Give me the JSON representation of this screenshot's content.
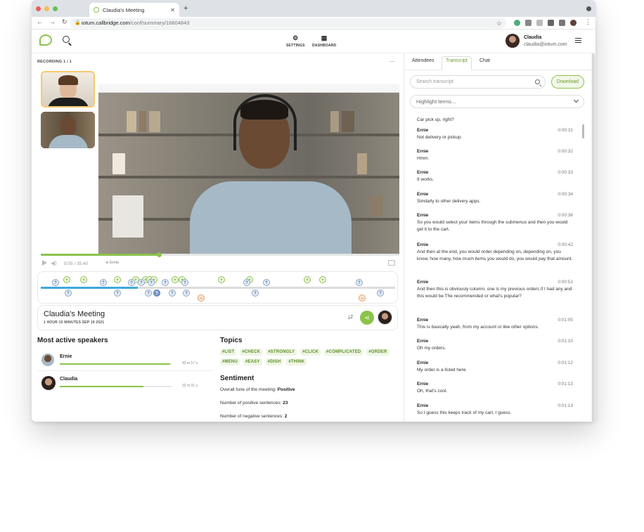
{
  "browser": {
    "tab_title": "Claudia's Meeting",
    "url_domain": "iotum.callbridge.com",
    "url_path": "/conf/summary/16604843"
  },
  "header": {
    "settings_label": "SETTINGS",
    "dashboard_label": "DASHBOARD",
    "user_name": "Claudia",
    "user_email": "claudia@iotum.com"
  },
  "recording": {
    "label": "RECORDING 1 / 1",
    "time_current": "9:05",
    "time_total": "35:40",
    "progress": 0.33,
    "active_speaker": "Ernie"
  },
  "meeting": {
    "title": "Claudia's Meeting",
    "meta": "1 HOUR 15 MINUTES   SEP 19 2021",
    "downloads": "2"
  },
  "speakers": {
    "heading": "Most active speakers",
    "items": [
      {
        "name": "Ernie",
        "duration": "43 m 17 s",
        "share": 0.99
      },
      {
        "name": "Claudia",
        "duration": "32 m 31 s",
        "share": 0.75
      }
    ]
  },
  "topics": {
    "heading": "Topics",
    "tags": [
      "#LIST",
      "#CHECK",
      "#STRONGLY",
      "#CLICK",
      "#COMPLICATED",
      "#ORDER",
      "#MENU",
      "#EASY",
      "#DISH",
      "#THINK"
    ]
  },
  "sentiment": {
    "heading": "Sentiment",
    "tone_label": "Overall tone of the meeting:",
    "tone_value": "Positive",
    "positive_label": "Number of positive sentences:",
    "positive_value": "23",
    "negative_label": "Number of negative sentences:",
    "negative_value": "2"
  },
  "panel": {
    "tabs": [
      "Attendees",
      "Transcript",
      "Chat"
    ],
    "active_tab": "Transcript",
    "search_placeholder": "Search transcript",
    "download_label": "Download",
    "highlight_placeholder": "Highlight terms..."
  },
  "transcript": {
    "lead": "Car pick up, right?",
    "entries": [
      {
        "speaker": "Ernie",
        "time": "0:00:31",
        "text": "Not delivery or pickup."
      },
      {
        "speaker": "Ernie",
        "time": "0:00:32",
        "text": "Hmm."
      },
      {
        "speaker": "Ernie",
        "time": "0:00:33",
        "text": "It works."
      },
      {
        "speaker": "Ernie",
        "time": "0:00:34",
        "text": "Similarly to other delivery apps."
      },
      {
        "speaker": "Ernie",
        "time": "0:00:36",
        "text": "So you would select your items through the submenus and then you would get it to the cart."
      },
      {
        "speaker": "Ernie",
        "time": "0:00:42",
        "text": "And then at the end, you would order depending on, depending on, you know, how many, how much items you would do, you would pay that amount."
      },
      {
        "speaker": "Ernie",
        "time": "0:00:51",
        "text": "And then this is obviously column, one is my previous orders if I had any and this would be The recommended or what's popular?"
      },
      {
        "speaker": "Ernie",
        "time": "0:01:05",
        "text": "This is basically yeah, from my account or like other options."
      },
      {
        "speaker": "Ernie",
        "time": "0:01:10",
        "text": "Oh my orders."
      },
      {
        "speaker": "Ernie",
        "time": "0:01:12",
        "text": "My order is a listed here."
      },
      {
        "speaker": "Ernie",
        "time": "0:01:13",
        "text": "Oh, that's cool."
      },
      {
        "speaker": "Ernie",
        "time": "0:01:13",
        "text": "So I guess this keeps track of my cart, I guess."
      }
    ]
  },
  "colors": {
    "accent": "#8bc34a",
    "timeline_played": "#3fa9dc"
  }
}
